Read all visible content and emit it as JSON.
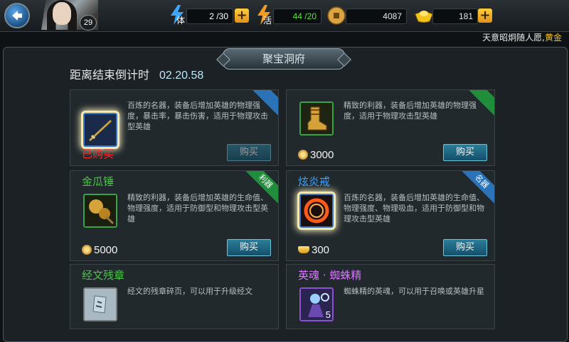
{
  "header": {
    "level": "29",
    "stamina": {
      "label": "体",
      "value": "2 /30"
    },
    "vitality": {
      "label": "活",
      "value": "44 /20"
    },
    "coins": {
      "value": "4087"
    },
    "gold": {
      "value": "181"
    }
  },
  "ticker": {
    "text": "天意昭炯随人愿,",
    "highlight": "黄金"
  },
  "shop": {
    "title": "聚宝洞府",
    "countdown_label": "距离结束倒计时",
    "countdown_value": "02.20.58"
  },
  "items": [
    {
      "name": "",
      "desc": "百炼的名器，装备后增加英雄的物理强度，暴击率，暴击伤害，适用于物理攻击型英雄",
      "status": "已购买",
      "button": "购买",
      "corner": ""
    },
    {
      "name": "",
      "desc": "精致的利器，装备后增加英雄的物理强度，适用于物理攻击型英雄",
      "price": "3000",
      "button": "购买",
      "corner": ""
    },
    {
      "name": "金瓜锤",
      "desc": "精致的利器，装备后增加英雄的生命值、物理强度，适用于防御型和物理攻击型英雄",
      "price": "5000",
      "button": "购买",
      "corner": "利器"
    },
    {
      "name": "炫炎戒",
      "desc": "百炼的名器，装备后增加英雄的生命值、物理强度、物理吸血，适用于防御型和物理攻击型英雄",
      "price": "300",
      "button": "购买",
      "corner": "名器"
    },
    {
      "name": "经文残章",
      "desc": "经文的残章碎页，可以用于升级经文"
    },
    {
      "name": "英魂 · 蜘蛛精",
      "desc": "蜘蛛精的英魂，可以用于召唤或英雄升星",
      "count": "5"
    }
  ],
  "colors": {
    "accent_gold": "#f2c31b",
    "green_name": "#4cc24a",
    "blue_name": "#3fa3ff",
    "purple_name": "#d778ff",
    "red_status": "#ff2a2a"
  }
}
